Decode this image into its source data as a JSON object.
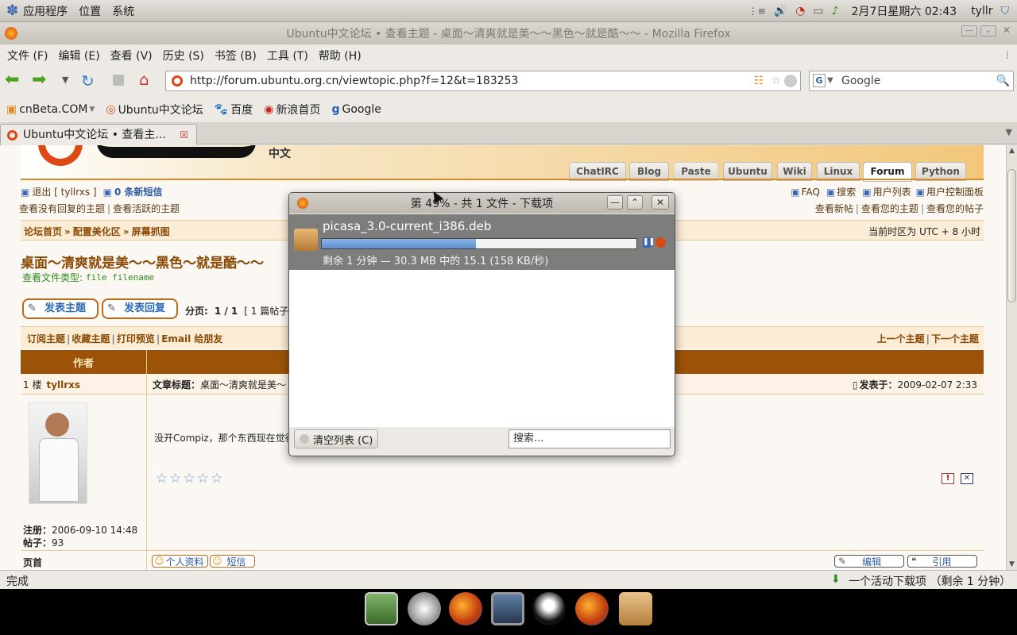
{
  "top_panel": {
    "apps_menu": "应用程序",
    "places_menu": "位置",
    "system_menu": "系统",
    "datetime": "2月7日星期六 02:43",
    "user": "tyllr"
  },
  "window": {
    "title": "Ubuntu中文论坛 • 查看主题 - 桌面～清爽就是美～～黑色～就是酷～～ - Mozilla Firefox"
  },
  "menubar": {
    "items": [
      "文件 (F)",
      "编辑 (E)",
      "查看 (V)",
      "历史 (S)",
      "书签 (B)",
      "工具 (T)",
      "帮助 (H)"
    ]
  },
  "navbar": {
    "url": "http://forum.ubuntu.org.cn/viewtopic.php?f=12&t=183253",
    "search_text": "Google"
  },
  "bookmarks": [
    "cnBeta.COM",
    "Ubuntu中文论坛",
    "百度",
    "新浪首页",
    "Google"
  ],
  "tab": {
    "label": "Ubuntu中文论坛 • 查看主..."
  },
  "forum": {
    "logo_cn": "中文",
    "nav_tabs": [
      "ChatIRC",
      "Blog",
      "Paste",
      "Ubuntu",
      "Wiki",
      "Linux",
      "Forum",
      "Python"
    ],
    "active_tab": "Forum",
    "logout": "退出 [ tyllrxs ]",
    "new_msgs": "0 条新短信",
    "faq": "FAQ",
    "search": "搜索",
    "members": "用户列表",
    "ucp": "用户控制面板",
    "unanswered": "查看没有回复的主题",
    "active": "查看活跃的主题",
    "new_posts": "查看新帖",
    "your_topics": "查看您的主题",
    "your_posts": "查看您的帖子",
    "breadcrumb": [
      "论坛首页",
      "配置美化区",
      "屏幕抓图"
    ],
    "timezone": "当前时区为 UTC + 8 小时",
    "topic_title": "桌面～清爽就是美～～黑色～就是酷～～",
    "filetype_label": "查看文件类型:",
    "filetype_value": "file filename",
    "post_topic": "发表主题",
    "post_reply": "发表回复",
    "pagination_label": "分页:",
    "pagination_value": "1 / 1",
    "post_count": "[ 1 篇帖子 ]",
    "subscribe": "订阅主题",
    "bookmark": "收藏主题",
    "print": "打印预览",
    "email": "Email 给朋友",
    "prev_topic": "上一个主题",
    "next_topic": "下一个主题",
    "col_author": "作者",
    "floor": "1 楼",
    "author": "tyllrxs",
    "subject_label": "文章标题：",
    "subject_value": "桌面～清爽就是美～",
    "posted_label": "发表于：",
    "posted_value": "2009-02-07 2:33",
    "body": "没开Compiz，那个东西现在觉得",
    "join_label": "注册：",
    "join_value": "2006-09-10 14:48",
    "posts_label": "帖子：",
    "posts_value": "93",
    "footer_label": "页首",
    "profile_btn": "个人资料",
    "pm_btn": "短信",
    "edit_btn": "编辑",
    "quote_btn": "引用"
  },
  "download_dialog": {
    "title": "第 49% - 共 1 文件 - 下载项",
    "filename": "picasa_3.0-current_i386.deb",
    "progress": 0.49,
    "status": "剩余 1 分钟 — 30.3 MB 中的 15.1 (158 KB/秒)",
    "clear_btn": "清空列表 (C)",
    "search_placeholder": "搜索..."
  },
  "statusbar": {
    "left": "完成",
    "right": "一个活动下载项 （剩余 1 分钟）"
  },
  "colors": {
    "forum_brown": "#9c5207",
    "link_orange": "#b06010",
    "progress_blue": "#5d8fd1"
  }
}
